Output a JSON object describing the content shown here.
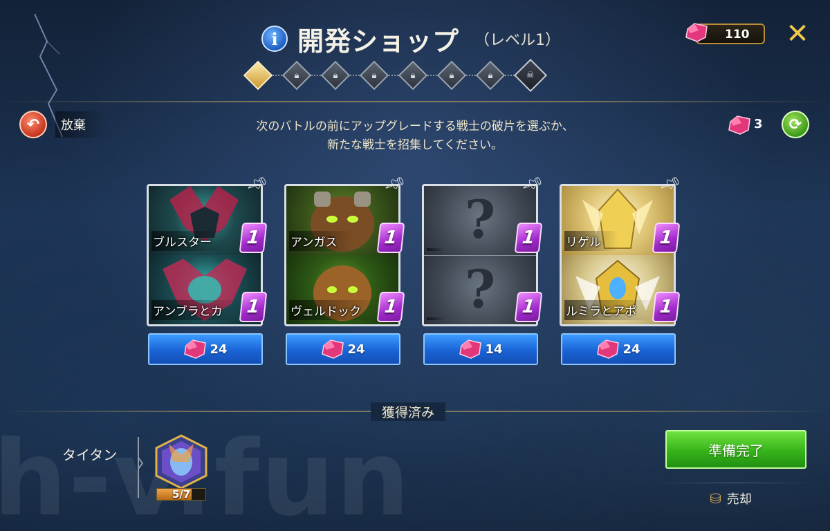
{
  "header": {
    "title": "開発ショップ",
    "level_label": "（レベル1）"
  },
  "level_track": {
    "nodes": [
      "active",
      "locked",
      "locked",
      "locked",
      "locked",
      "locked",
      "locked",
      "boss"
    ]
  },
  "currency": {
    "value": "110",
    "icon": "gem-icon"
  },
  "abandon": {
    "label": "放棄"
  },
  "instructions": {
    "line1": "次のバトルの前にアップグレードする戦士の破片を選ぶか、",
    "line2": "新たな戦士を招集してください。"
  },
  "refresh": {
    "count": "3"
  },
  "cards": [
    {
      "top_name": "ブルスター",
      "top_qty": "1",
      "bottom_name": "アンブラとカ",
      "bottom_qty": "1",
      "price": "24"
    },
    {
      "top_name": "アンガス",
      "top_qty": "1",
      "bottom_name": "ヴェルドック",
      "bottom_qty": "1",
      "price": "24"
    },
    {
      "top_name": "",
      "top_qty": "1",
      "bottom_name": "",
      "bottom_qty": "1",
      "price": "14"
    },
    {
      "top_name": "リゲル",
      "top_qty": "1",
      "bottom_name": "ルミラとアポ",
      "bottom_qty": "1",
      "price": "24"
    }
  ],
  "acquired": {
    "label": "獲得済み"
  },
  "team": {
    "label": "タイタン",
    "progress_text": "5/7",
    "progress": 0.714
  },
  "buttons": {
    "ready": "準備完了",
    "sell": "売却"
  },
  "watermark": "h-v.fun",
  "colors": {
    "accent_gold": "#c8aa64",
    "price_button": "#1a63d6",
    "ready_button": "#36b31a",
    "quantity_badge": "#a12acb"
  }
}
